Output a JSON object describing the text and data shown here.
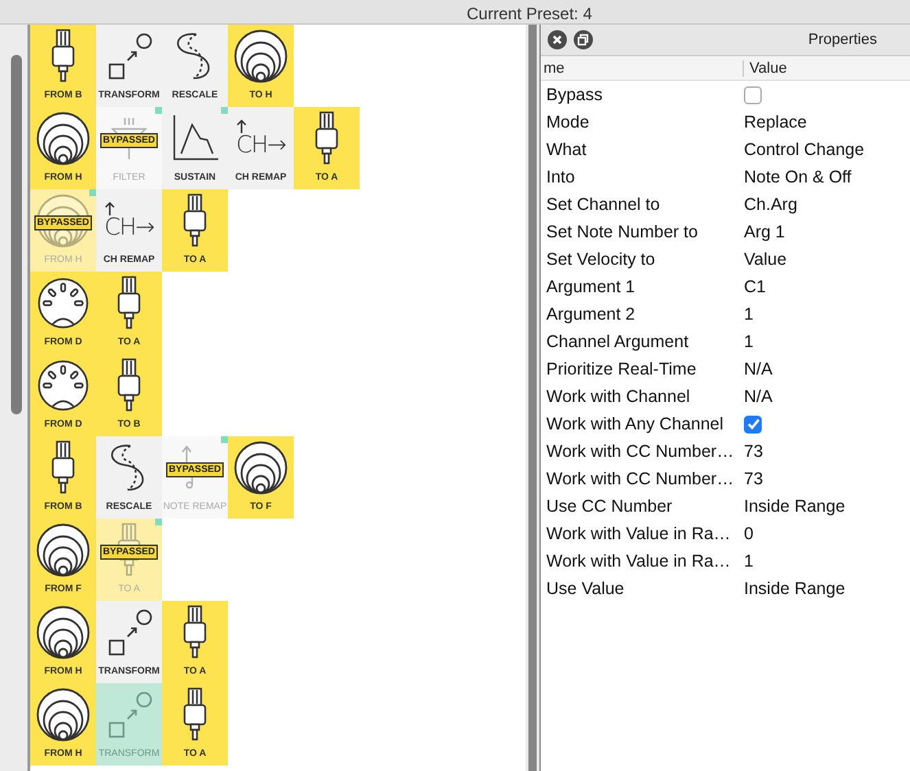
{
  "window": {
    "title": "Current Preset: 4"
  },
  "chains": [
    {
      "tiles": [
        {
          "kind": "rca",
          "label": "FROM B",
          "color": "#fde34f",
          "bypassed": false,
          "flagged": false,
          "selected": false
        },
        {
          "kind": "transform",
          "label": "TRANSFORM",
          "color": "#f1f1f1",
          "bypassed": false,
          "flagged": false,
          "selected": false
        },
        {
          "kind": "rescale",
          "label": "RESCALE",
          "color": "#f1f1f1",
          "bypassed": false,
          "flagged": false,
          "selected": false
        },
        {
          "kind": "speaker",
          "label": "TO H",
          "color": "#fde34f",
          "bypassed": false,
          "flagged": false,
          "selected": false
        }
      ]
    },
    {
      "tiles": [
        {
          "kind": "speaker",
          "label": "FROM H",
          "color": "#fde34f",
          "bypassed": false,
          "flagged": false,
          "selected": false
        },
        {
          "kind": "filter",
          "label": "FILTER",
          "color": "#f8f8f8",
          "bypassed": true,
          "badge": "BYPASSED",
          "flagged": true,
          "selected": false
        },
        {
          "kind": "sustain",
          "label": "SUSTAIN",
          "color": "#f1f1f1",
          "bypassed": false,
          "flagged": true,
          "selected": false
        },
        {
          "kind": "ch-remap",
          "glyph": "CH→",
          "label": "CH REMAP",
          "color": "#f1f1f1",
          "bypassed": false,
          "flagged": false,
          "selected": false
        },
        {
          "kind": "rca",
          "label": "TO A",
          "color": "#fde34f",
          "bypassed": false,
          "flagged": false,
          "selected": false
        }
      ]
    },
    {
      "tiles": [
        {
          "kind": "speaker",
          "label": "FROM H",
          "color": "#fdf0a6",
          "bypassed": true,
          "badge": "BYPASSED",
          "flagged": true,
          "selected": false
        },
        {
          "kind": "ch-remap",
          "glyph": "CH→",
          "label": "CH REMAP",
          "color": "#f1f1f1",
          "bypassed": false,
          "flagged": false,
          "selected": false
        },
        {
          "kind": "rca",
          "label": "TO A",
          "color": "#fde34f",
          "bypassed": false,
          "flagged": false,
          "selected": false
        }
      ]
    },
    {
      "tiles": [
        {
          "kind": "din",
          "label": "FROM D",
          "color": "#fde34f",
          "bypassed": false,
          "flagged": false,
          "selected": false
        },
        {
          "kind": "rca",
          "label": "TO A",
          "color": "#fde34f",
          "bypassed": false,
          "flagged": false,
          "selected": false
        }
      ]
    },
    {
      "tiles": [
        {
          "kind": "din",
          "label": "FROM D",
          "color": "#fde34f",
          "bypassed": false,
          "flagged": false,
          "selected": false
        },
        {
          "kind": "rca",
          "label": "TO B",
          "color": "#fde34f",
          "bypassed": false,
          "flagged": false,
          "selected": false
        }
      ]
    },
    {
      "tiles": [
        {
          "kind": "rca",
          "label": "FROM B",
          "color": "#fde34f",
          "bypassed": false,
          "flagged": false,
          "selected": false
        },
        {
          "kind": "rescale",
          "label": "RESCALE",
          "color": "#f1f1f1",
          "bypassed": false,
          "flagged": false,
          "selected": false
        },
        {
          "kind": "note-remap",
          "label": "NOTE REMAP",
          "color": "#f8f8f8",
          "bypassed": true,
          "badge": "BYPASSED",
          "flagged": true,
          "selected": false
        },
        {
          "kind": "speaker",
          "label": "TO F",
          "color": "#fde34f",
          "bypassed": false,
          "flagged": false,
          "selected": false
        }
      ]
    },
    {
      "tiles": [
        {
          "kind": "speaker",
          "label": "FROM F",
          "color": "#fde34f",
          "bypassed": false,
          "flagged": false,
          "selected": false
        },
        {
          "kind": "rca",
          "label": "TO A",
          "color": "#fdf0a6",
          "bypassed": true,
          "badge": "BYPASSED",
          "flagged": true,
          "selected": false
        }
      ]
    },
    {
      "tiles": [
        {
          "kind": "speaker",
          "label": "FROM H",
          "color": "#fde34f",
          "bypassed": false,
          "flagged": false,
          "selected": false
        },
        {
          "kind": "transform",
          "label": "TRANSFORM",
          "color": "#f1f1f1",
          "bypassed": false,
          "flagged": false,
          "selected": false
        },
        {
          "kind": "rca",
          "label": "TO A",
          "color": "#fde34f",
          "bypassed": false,
          "flagged": false,
          "selected": false
        }
      ]
    },
    {
      "tiles": [
        {
          "kind": "speaker",
          "label": "FROM H",
          "color": "#fde34f",
          "bypassed": false,
          "flagged": false,
          "selected": false
        },
        {
          "kind": "transform",
          "label": "TRANSFORM",
          "color": "#bfe8d9",
          "bypassed": false,
          "flagged": false,
          "selected": true
        },
        {
          "kind": "rca",
          "label": "TO A",
          "color": "#fde34f",
          "bypassed": false,
          "flagged": false,
          "selected": false
        }
      ]
    }
  ],
  "properties": {
    "title": "Properties",
    "columns": [
      "me",
      "Value"
    ],
    "rows": [
      {
        "name": "Bypass",
        "kind": "checkbox",
        "checked": false
      },
      {
        "name": "Mode",
        "kind": "text",
        "value": "Replace"
      },
      {
        "name": "What",
        "kind": "text",
        "value": "Control Change"
      },
      {
        "name": "Into",
        "kind": "text",
        "value": "Note On & Off"
      },
      {
        "name": "Set Channel to",
        "kind": "text",
        "value": "Ch.Arg"
      },
      {
        "name": "Set Note Number to",
        "kind": "text",
        "value": "Arg 1"
      },
      {
        "name": "Set Velocity to",
        "kind": "text",
        "value": "Value"
      },
      {
        "name": "Argument 1",
        "kind": "text",
        "value": "C1"
      },
      {
        "name": "Argument 2",
        "kind": "text",
        "value": "1"
      },
      {
        "name": "Channel Argument",
        "kind": "text",
        "value": "1"
      },
      {
        "name": "Prioritize Real-Time",
        "kind": "text",
        "value": "N/A"
      },
      {
        "name": "Work with Channel",
        "kind": "text",
        "value": "N/A"
      },
      {
        "name": "Work with Any Channel",
        "kind": "checkbox",
        "checked": true
      },
      {
        "name": "Work with CC Number…",
        "kind": "text",
        "value": "73"
      },
      {
        "name": "Work with CC Number…",
        "kind": "text",
        "value": "73"
      },
      {
        "name": "Use CC Number",
        "kind": "text",
        "value": "Inside Range"
      },
      {
        "name": "Work with Value in Ra…",
        "kind": "text",
        "value": "0"
      },
      {
        "name": "Work with Value in Ra…",
        "kind": "text",
        "value": "1"
      },
      {
        "name": "Use Value",
        "kind": "text",
        "value": "Inside Range"
      }
    ]
  }
}
